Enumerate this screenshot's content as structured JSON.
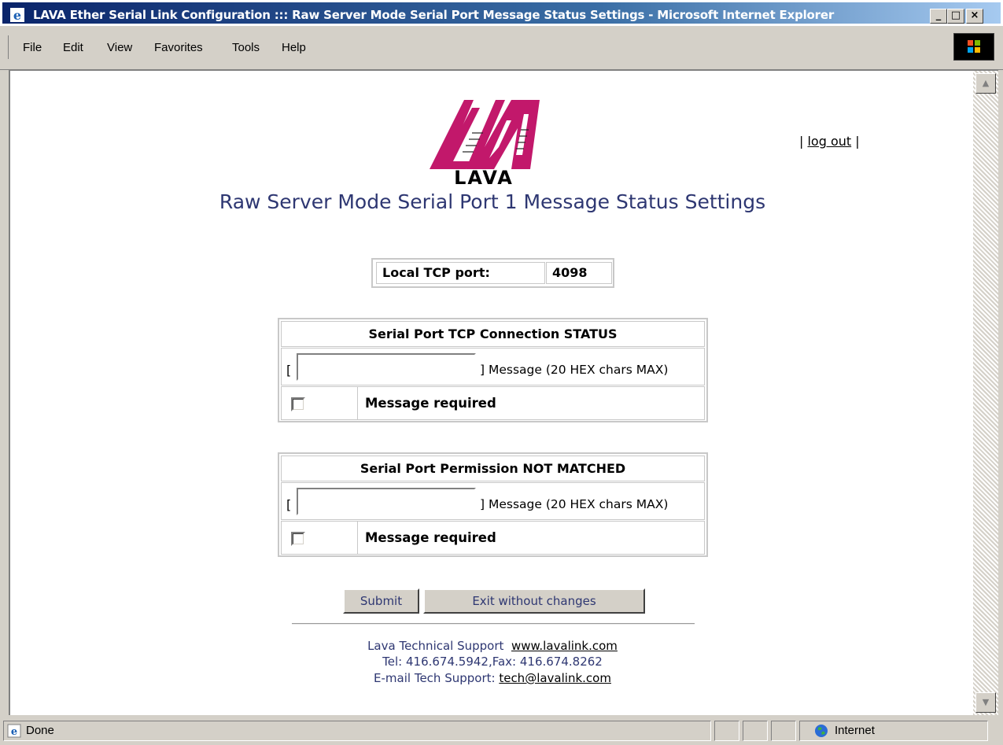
{
  "window": {
    "title": "LAVA Ether Serial Link Configuration ::: Raw Server Mode Serial Port Message Status Settings - Microsoft Internet Explorer",
    "controls": {
      "minimize": "_",
      "maximize": "□",
      "close": "×"
    }
  },
  "menu": {
    "items": [
      "File",
      "Edit",
      "View",
      "Favorites",
      "Tools",
      "Help"
    ]
  },
  "page": {
    "logo_text": "LAVA",
    "logout_left": "|",
    "logout_label": "log out",
    "logout_right": "|",
    "title": "Raw Server Mode Serial Port 1 Message Status Settings",
    "tcp": {
      "label": "Local TCP port:",
      "value": "4098"
    },
    "groups": [
      {
        "heading": "Serial Port TCP Connection STATUS",
        "open_bracket": "[",
        "message_value": "",
        "message_label": "] Message (20 HEX chars MAX)",
        "required_label": "Message required",
        "required_checked": false
      },
      {
        "heading": "Serial Port Permission NOT MATCHED",
        "open_bracket": "[",
        "message_value": "",
        "message_label": "] Message (20 HEX chars MAX)",
        "required_label": "Message required",
        "required_checked": false
      }
    ],
    "buttons": {
      "submit": "Submit",
      "exit": "Exit without changes"
    },
    "footer": {
      "support_label": "Lava Technical Support",
      "support_link": "www.lavalink.com",
      "phone": "Tel: 416.674.5942,Fax: 416.674.8262",
      "email_label": "E-mail Tech Support:",
      "email_link": "tech@lavalink.com"
    }
  },
  "status": {
    "text": "Done",
    "zone": "Internet"
  },
  "colors": {
    "title_text": "#2e3772",
    "logo": "#c2186b",
    "titlebar": "#0a246a"
  }
}
